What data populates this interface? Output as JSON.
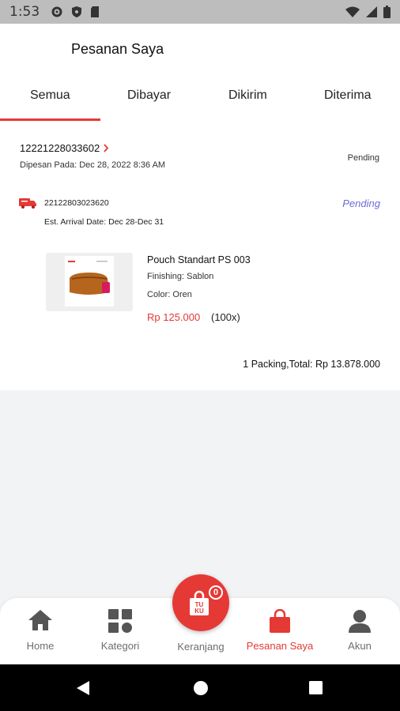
{
  "status_bar": {
    "time": "1:53"
  },
  "header": {
    "title": "Pesanan Saya"
  },
  "tabs": [
    {
      "label": "Semua",
      "active": true
    },
    {
      "label": "Dibayar",
      "active": false
    },
    {
      "label": "Dikirim",
      "active": false
    },
    {
      "label": "Diterima",
      "active": false
    }
  ],
  "order": {
    "id": "12221228033602",
    "date": "Dipesan Pada: Dec 28, 2022 8:36 AM",
    "status": "Pending",
    "shipment": {
      "id": "22122803023620",
      "status": "Pending",
      "arrival": "Est. Arrival Date: Dec 28-Dec 31"
    },
    "product": {
      "name": "Pouch Standart PS 003",
      "finishing": "Finishing: Sablon",
      "color": "Color: Oren",
      "price": "Rp 125.000",
      "quantity": "(100x)"
    },
    "total": "1 Packing,Total: Rp 13.878.000"
  },
  "bottom_nav": {
    "items": [
      {
        "label": "Home",
        "icon": "home-icon"
      },
      {
        "label": "Kategori",
        "icon": "grid-icon"
      },
      {
        "label": "Keranjang",
        "icon": "cart-bag-icon",
        "badge": "0"
      },
      {
        "label": "Pesanan Saya",
        "icon": "shopping-bag-icon",
        "active": true
      },
      {
        "label": "Akun",
        "icon": "user-icon"
      }
    ]
  },
  "colors": {
    "accent": "#e53935",
    "pending_link": "#6b6bd8"
  }
}
